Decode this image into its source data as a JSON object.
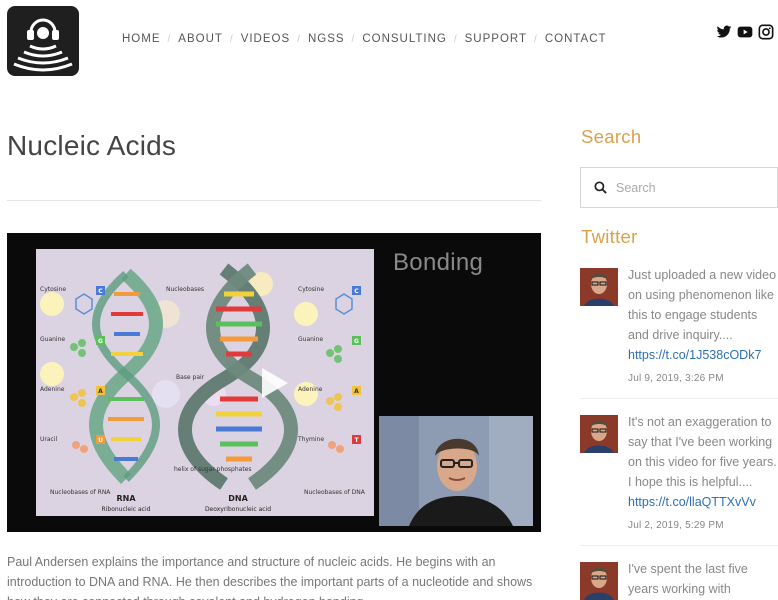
{
  "header": {
    "logo_icon": "headphones-waves-logo",
    "nav": [
      {
        "label": "HOME"
      },
      {
        "label": "ABOUT"
      },
      {
        "label": "VIDEOS"
      },
      {
        "label": "NGSS"
      },
      {
        "label": "CONSULTING"
      },
      {
        "label": "SUPPORT"
      },
      {
        "label": "CONTACT"
      }
    ],
    "nav_separator": "/",
    "social_icons": [
      "twitter-icon",
      "youtube-icon",
      "instagram-icon"
    ]
  },
  "main": {
    "title": "Nucleic Acids",
    "video": {
      "slide_title": "Bonding",
      "slide_labels": {
        "nucleobases_top": "Nucleobases",
        "cytosine_left": "Cytosine",
        "cytosine_right": "Cytosine",
        "guanine_left": "Guanine",
        "guanine_right": "Guanine",
        "adenine_left": "Adenine",
        "adenine_right": "Adenine",
        "uracil": "Uracil",
        "thymine": "Thymine",
        "base_pair": "Base pair",
        "helix": "helix of sugar-phosphates",
        "nucleobases_rna": "Nucleobases of RNA",
        "nucleobases_dna": "Nucleobases of DNA",
        "rna": "RNA",
        "rna_full": "Ribonucleic acid",
        "dna": "DNA",
        "dna_full": "Deoxyribonucleic acid",
        "tag_c": "C",
        "tag_g": "G",
        "tag_a": "A",
        "tag_u": "U",
        "tag_t": "T"
      }
    },
    "summary": "Paul Andersen explains the importance and structure of nucleic acids. He begins with an introduction to DNA and RNA. He then describes the important parts of a nucleotide and shows how they are connected through covalent and hydrogen bonding."
  },
  "sidebar": {
    "search_heading": "Search",
    "search_placeholder": "Search",
    "twitter_heading": "Twitter",
    "tweets": [
      {
        "text": "Just uploaded a new video on using phenomenon like this to engage students and drive inquiry....",
        "link": "https://t.co/1J538cODk7",
        "date": "Jul 9, 2019, 3:26 PM"
      },
      {
        "text": "It's not an exaggeration to say that I've been working on this video for five years. I hope this is helpful....",
        "link": "https://t.co/llaQTTXvVv",
        "date": "Jul 2, 2019, 5:29 PM"
      },
      {
        "text": "I've spent the last five years working with",
        "link": "",
        "date": ""
      }
    ]
  },
  "colors": {
    "accent": "#d8a24a",
    "link": "#2c6fb5",
    "text": "#444444",
    "muted": "#888888"
  }
}
